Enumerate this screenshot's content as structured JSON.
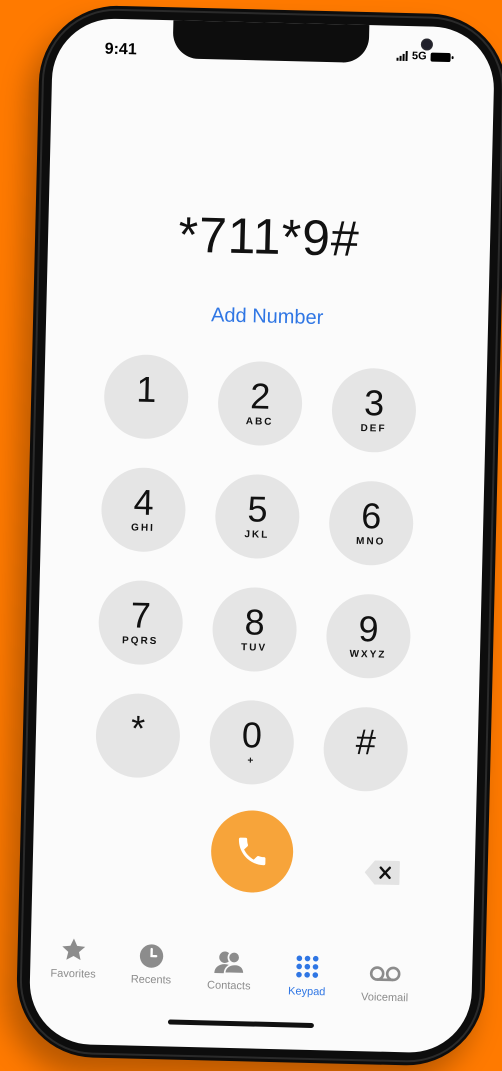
{
  "status_bar": {
    "time": "9:41",
    "network": "5G"
  },
  "dialer": {
    "number": "*711*9#",
    "add_number": "Add Number"
  },
  "keypad": [
    {
      "digit": "1",
      "letters": ""
    },
    {
      "digit": "2",
      "letters": "ABC"
    },
    {
      "digit": "3",
      "letters": "DEF"
    },
    {
      "digit": "4",
      "letters": "GHI"
    },
    {
      "digit": "5",
      "letters": "JKL"
    },
    {
      "digit": "6",
      "letters": "MNO"
    },
    {
      "digit": "7",
      "letters": "PQRS"
    },
    {
      "digit": "8",
      "letters": "TUV"
    },
    {
      "digit": "9",
      "letters": "WXYZ"
    },
    {
      "digit": "*",
      "letters": ""
    },
    {
      "digit": "0",
      "letters": "+"
    },
    {
      "digit": "#",
      "letters": ""
    }
  ],
  "tabs": [
    {
      "label": "Favorites",
      "icon": "star-icon"
    },
    {
      "label": "Recents",
      "icon": "clock-icon"
    },
    {
      "label": "Contacts",
      "icon": "contacts-icon"
    },
    {
      "label": "Keypad",
      "icon": "keypad-icon",
      "active": true
    },
    {
      "label": "Voicemail",
      "icon": "voicemail-icon"
    }
  ],
  "colors": {
    "background": "#ff7a00",
    "accent": "#2f76e4",
    "call": "#f7a43a",
    "key": "#e5e5e5"
  }
}
